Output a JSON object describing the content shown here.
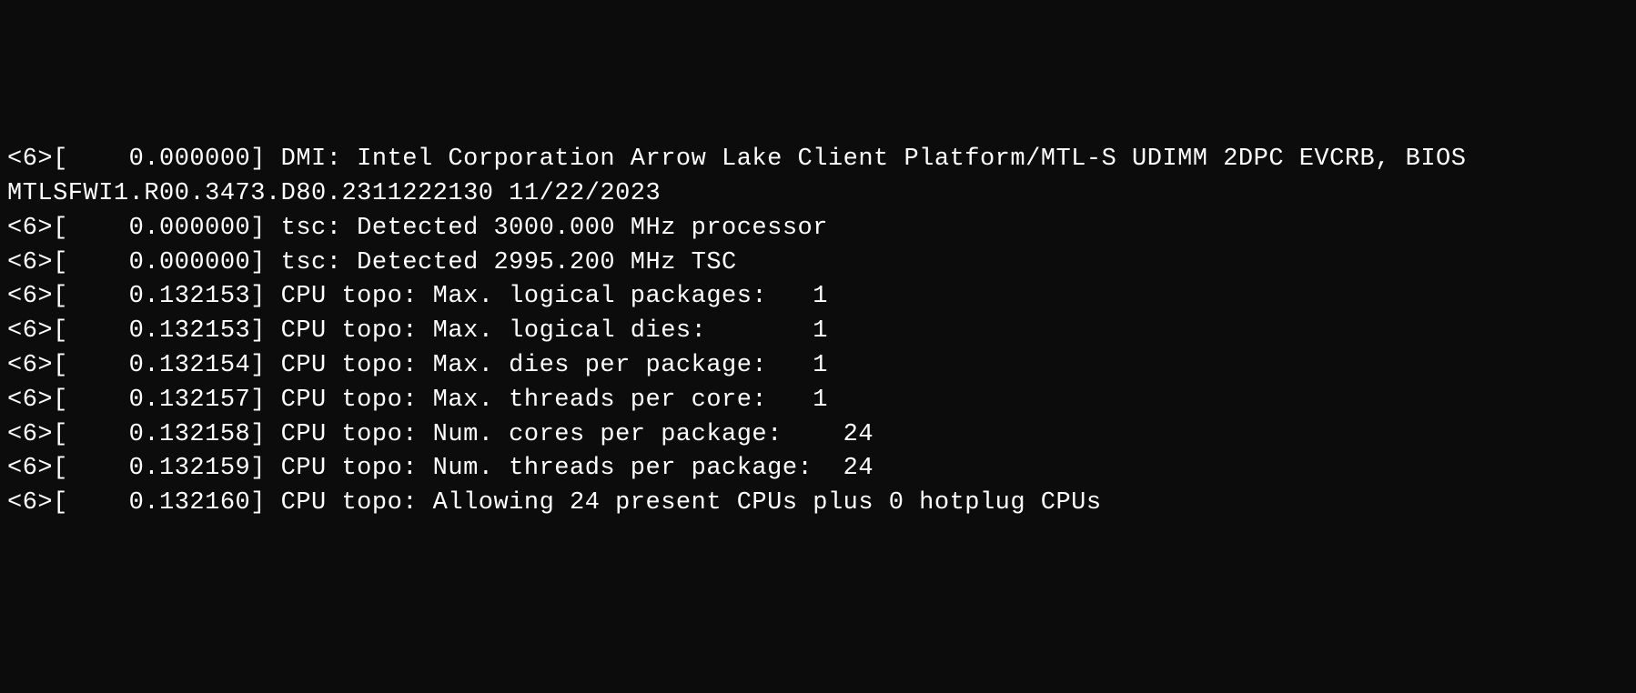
{
  "log_lines": [
    "<6>[    0.000000] DMI: Intel Corporation Arrow Lake Client Platform/MTL-S UDIMM 2DPC EVCRB, BIOS MTLSFWI1.R00.3473.D80.2311222130 11/22/2023",
    "<6>[    0.000000] tsc: Detected 3000.000 MHz processor",
    "<6>[    0.000000] tsc: Detected 2995.200 MHz TSC",
    "<6>[    0.132153] CPU topo: Max. logical packages:   1",
    "<6>[    0.132153] CPU topo: Max. logical dies:       1",
    "<6>[    0.132154] CPU topo: Max. dies per package:   1",
    "<6>[    0.132157] CPU topo: Max. threads per core:   1",
    "<6>[    0.132158] CPU topo: Num. cores per package:    24",
    "<6>[    0.132159] CPU topo: Num. threads per package:  24",
    "<6>[    0.132160] CPU topo: Allowing 24 present CPUs plus 0 hotplug CPUs"
  ]
}
